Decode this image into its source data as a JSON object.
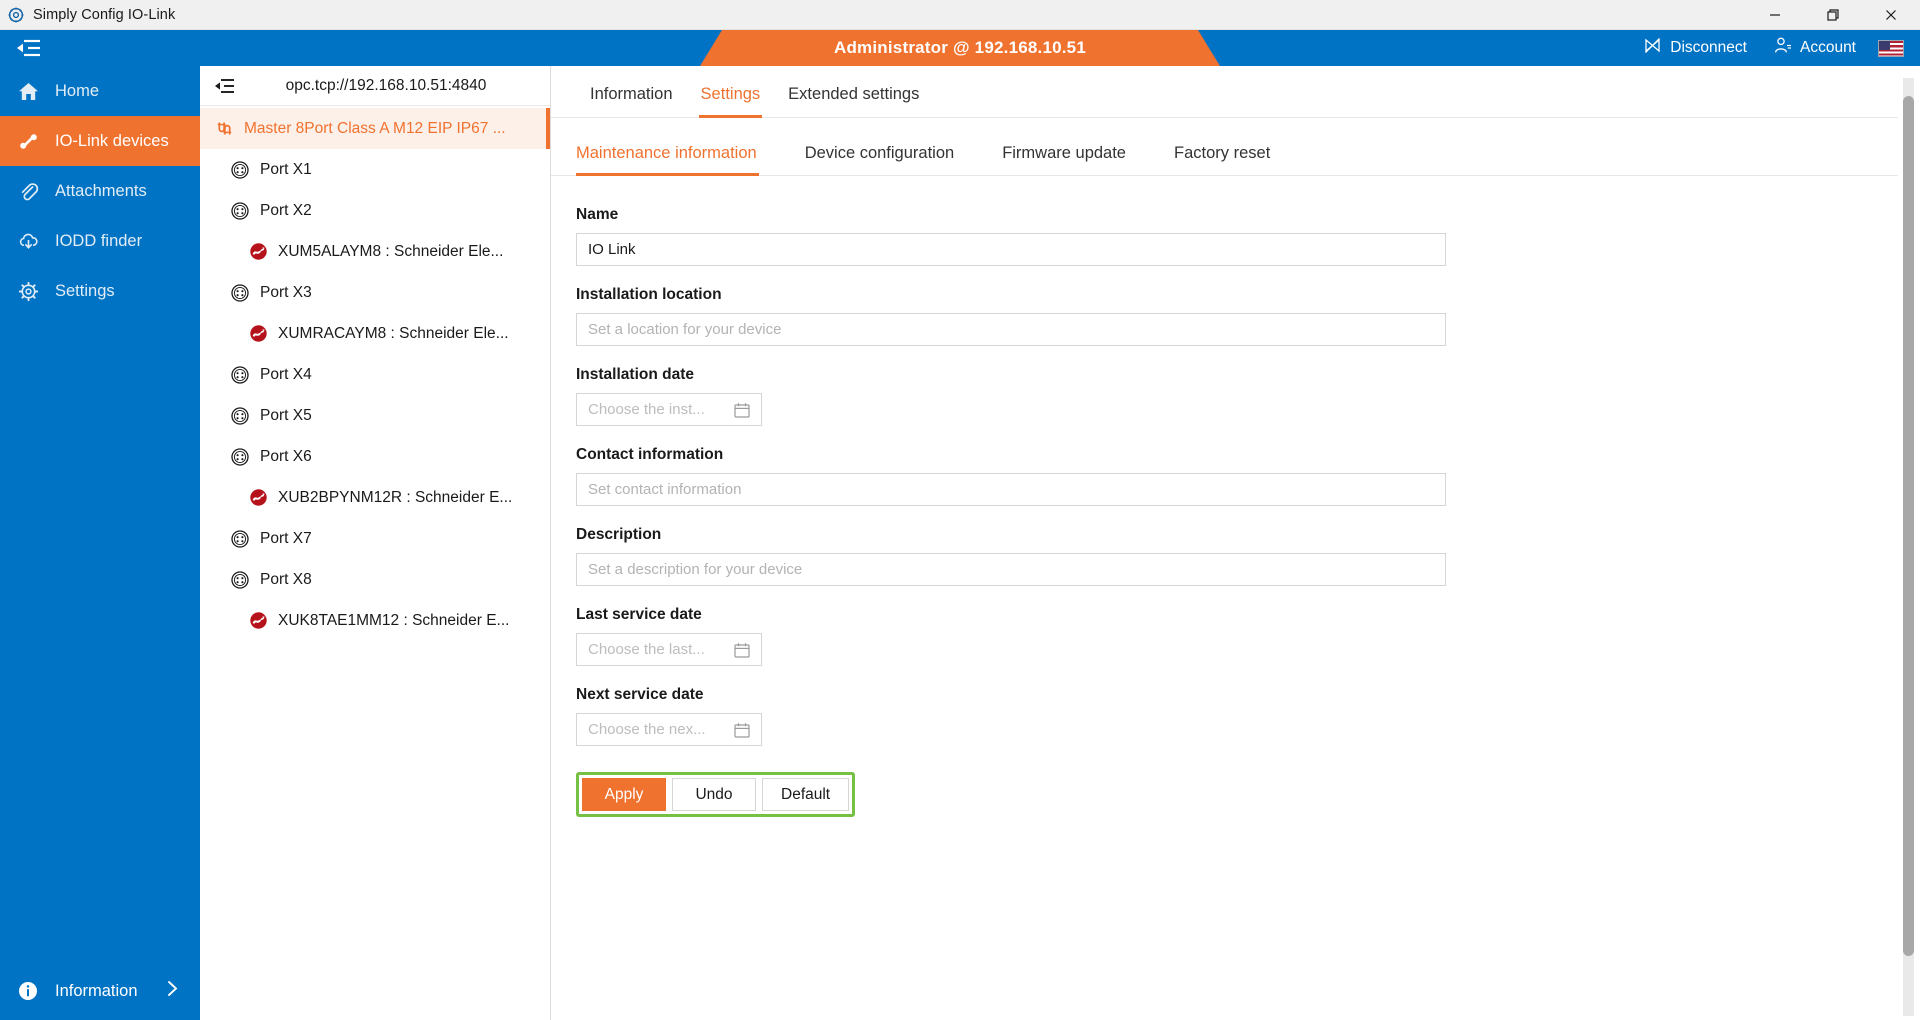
{
  "titlebar": {
    "app_icon": "gear-app-icon",
    "title": "Simply Config IO-Link",
    "minimize": "minimize-icon",
    "maximize": "restore-icon",
    "close": "close-icon"
  },
  "header": {
    "menu_icon": "collapse-menu-icon",
    "banner_text": "Administrator @ 192.168.10.51",
    "banner_color": "#f0722f",
    "bar_color": "#0073c4",
    "disconnect_label": "Disconnect",
    "disconnect_icon": "disconnect-icon",
    "account_label": "Account",
    "account_icon": "person-icon",
    "language_flag": "us-flag-icon"
  },
  "sidebar": {
    "items": [
      {
        "label": "Home",
        "icon": "home-icon",
        "active": false
      },
      {
        "label": "IO-Link devices",
        "icon": "plug-icon",
        "active": true
      },
      {
        "label": "Attachments",
        "icon": "paperclip-icon",
        "active": false
      },
      {
        "label": "IODD finder",
        "icon": "cloud-download-icon",
        "active": false
      },
      {
        "label": "Settings",
        "icon": "gear-icon",
        "active": false
      }
    ],
    "bottom": {
      "label": "Information",
      "icon": "info-icon",
      "chevron": "chevron-right-icon"
    }
  },
  "tree": {
    "toggle_icon": "collapse-panel-icon",
    "endpoint": "opc.tcp://192.168.10.51:4840",
    "rows": [
      {
        "label": "Master 8Port Class A M12 EIP IP67 ...",
        "level": "master",
        "icon": "io-link-master-icon",
        "selected": true
      },
      {
        "label": "Port X1",
        "level": "port",
        "icon": "m12-port-icon",
        "selected": false
      },
      {
        "label": "Port X2",
        "level": "port",
        "icon": "m12-port-icon",
        "selected": false
      },
      {
        "label": "XUM5ALAYM8 : Schneider Ele...",
        "level": "dev",
        "icon": "sensor-device-icon",
        "selected": false
      },
      {
        "label": "Port X3",
        "level": "port",
        "icon": "m12-port-icon",
        "selected": false
      },
      {
        "label": "XUMRACAYM8 : Schneider Ele...",
        "level": "dev",
        "icon": "sensor-device-icon",
        "selected": false
      },
      {
        "label": "Port X4",
        "level": "port",
        "icon": "m12-port-icon",
        "selected": false
      },
      {
        "label": "Port X5",
        "level": "port",
        "icon": "m12-port-icon",
        "selected": false
      },
      {
        "label": "Port X6",
        "level": "port",
        "icon": "m12-port-icon",
        "selected": false
      },
      {
        "label": "XUB2BPYNM12R : Schneider E...",
        "level": "dev",
        "icon": "sensor-device-icon",
        "selected": false
      },
      {
        "label": "Port X7",
        "level": "port",
        "icon": "m12-port-icon",
        "selected": false
      },
      {
        "label": "Port X8",
        "level": "port",
        "icon": "m12-port-icon",
        "selected": false
      },
      {
        "label": "XUK8TAE1MM12 : Schneider E...",
        "level": "dev",
        "icon": "sensor-device-icon",
        "selected": false
      }
    ]
  },
  "main": {
    "primary_tabs": [
      {
        "label": "Information",
        "active": false
      },
      {
        "label": "Settings",
        "active": true
      },
      {
        "label": "Extended settings",
        "active": false
      }
    ],
    "secondary_tabs": [
      {
        "label": "Maintenance information",
        "active": true
      },
      {
        "label": "Device configuration",
        "active": false
      },
      {
        "label": "Firmware update",
        "active": false
      },
      {
        "label": "Factory reset",
        "active": false
      }
    ],
    "fields": [
      {
        "label": "Name",
        "value": "IO Link",
        "placeholder": "",
        "type": "text"
      },
      {
        "label": "Installation location",
        "value": "",
        "placeholder": "Set a location for your device",
        "type": "text"
      },
      {
        "label": "Installation date",
        "value": "",
        "placeholder": "Choose the inst...",
        "type": "date"
      },
      {
        "label": "Contact information",
        "value": "",
        "placeholder": "Set contact information",
        "type": "text"
      },
      {
        "label": "Description",
        "value": "",
        "placeholder": "Set a description for your device",
        "type": "text"
      },
      {
        "label": "Last service date",
        "value": "",
        "placeholder": "Choose the last...",
        "type": "date"
      },
      {
        "label": "Next service date",
        "value": "",
        "placeholder": "Choose the nex...",
        "type": "date"
      }
    ],
    "buttons": [
      {
        "label": "Apply",
        "style": "primary"
      },
      {
        "label": "Undo",
        "style": "default"
      },
      {
        "label": "Default",
        "style": "default"
      }
    ],
    "highlight_color": "#76c043"
  }
}
